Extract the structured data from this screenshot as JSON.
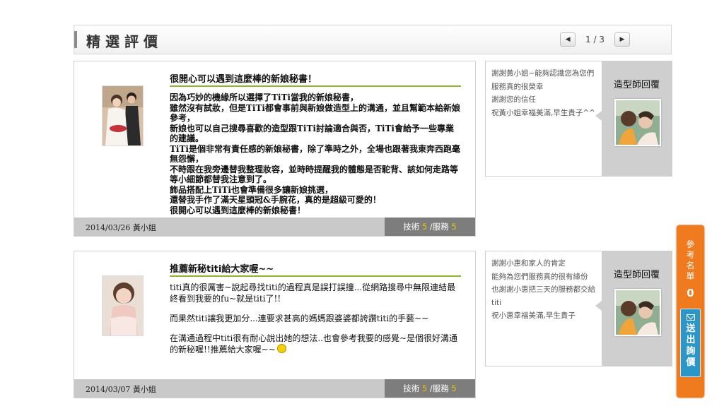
{
  "header": {
    "title": "精選評價",
    "page_indicator": "1 / 3"
  },
  "reviews": [
    {
      "title": "很開心可以遇到這麼棒的新娘秘書！",
      "body": [
        "因為巧妙的機緣所以選擇了TiTi當我的新娘秘書，",
        "雖然沒有試妝，但是TiTi都會事前與新娘做造型上的溝通，並且幫範本給新娘參考，",
        "新娘也可以自己搜尋喜歡的造型跟TiTi討論適合與否，TiTi會給予一些專業的建議。",
        "TiTi是個非常有責任感的新娘秘書，除了準時之外，全場也跟著我東奔西跑毫無怨懈，",
        "不時跟在我旁邊替我整理妝容，並時時提醒我的體態是否駝背、該如何走路等等小細節都替我注意到了。",
        "飾品搭配上TiTi也會準備很多讓新娘挑選，",
        "還替我手作了滿天星頭冠&手腕花，真的是超級可愛的！",
        "很開心可以遇到這麼棒的新娘秘書！"
      ],
      "date": "2014/03/26 黃小姐",
      "rating_skill_label": "技術",
      "rating_skill": "5",
      "rating_service_label": "服務",
      "rating_service": "5",
      "reply": {
        "lines": [
          "謝謝黃小姐~能夠認識您為您們服務真的很榮幸",
          "謝謝您的信任",
          "祝黃小姐幸福美滿,早生貴子^^"
        ],
        "label": "造型師回覆"
      }
    },
    {
      "title": "推薦新秘titi給大家喔~~",
      "body": [
        "titi真的很厲害~說起尋找titi的過程真是誤打誤撞...從網路搜尋中無限連結最終看到我要的fu~就是titi了!!",
        "而果然titi讓我更加分...連要求甚高的媽媽跟婆婆都誇讚titi的手藝~~",
        "在溝通過程中titi很有耐心說出她的想法..也會參考我要的感覺~是個很好溝通的新秘喔!!推薦給大家喔~~"
      ],
      "date": "2014/03/07 黃小姐",
      "rating_skill_label": "技術",
      "rating_skill": "5",
      "rating_service_label": "服務",
      "rating_service": "5",
      "reply": {
        "lines": [
          "謝謝小惠和家人的肯定",
          "能夠為您們服務真的很有緣份",
          "也謝謝小惠把三天的服務都交給titi",
          "祝小惠幸福美滿,早生貴子"
        ],
        "label": "造型師回覆"
      }
    }
  ],
  "floater": {
    "label": "參考名單",
    "count": "0",
    "send_label": "送出詢價"
  },
  "colors": {
    "accent_green": "#8fb530",
    "floater_orange": "#f07a1e",
    "send_blue": "#2b97c8",
    "score_yellow": "#e6c200"
  },
  "icons": [
    "prev-page-icon",
    "next-page-icon",
    "mail-icon",
    "smiley-icon"
  ]
}
